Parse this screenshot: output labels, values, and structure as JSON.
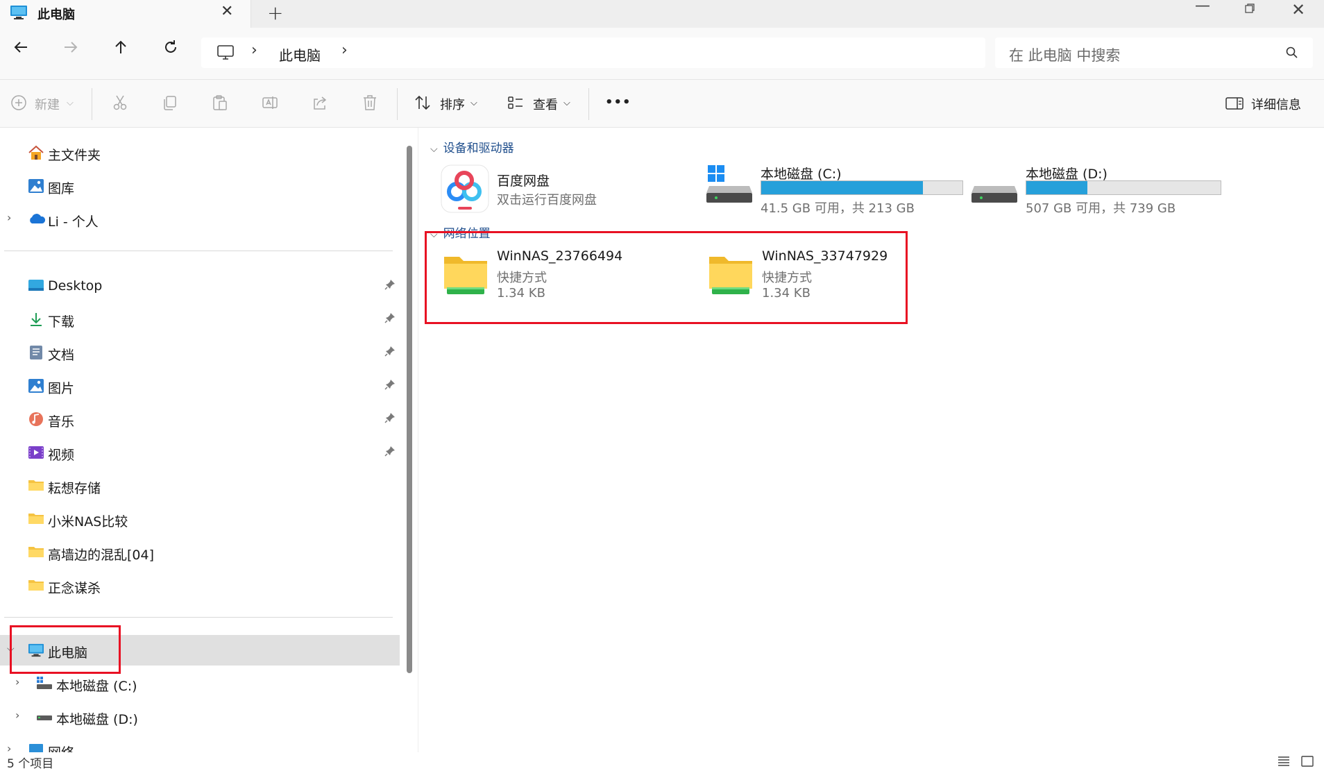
{
  "window": {
    "tab_title": "此电脑",
    "close_tab_glyph": "✕",
    "new_tab_glyph": "+",
    "minimize_glyph": "—",
    "close_window_glyph": "✕"
  },
  "address": {
    "breadcrumb": "此电脑",
    "search_placeholder": "在 此电脑 中搜索"
  },
  "toolbar": {
    "new_label": "新建",
    "sort_label": "排序",
    "view_label": "查看",
    "more_label": "•••",
    "details_label": "详细信息"
  },
  "sidebar": {
    "top": [
      {
        "label": "主文件夹",
        "icon": "home-icon"
      },
      {
        "label": "图库",
        "icon": "gallery-icon"
      },
      {
        "label": "Li - 个人",
        "icon": "onedrive-icon"
      }
    ],
    "quick": [
      {
        "label": "Desktop",
        "icon": "desktop-icon",
        "pinned": true
      },
      {
        "label": "下载",
        "icon": "download-icon",
        "pinned": true
      },
      {
        "label": "文档",
        "icon": "document-icon",
        "pinned": true
      },
      {
        "label": "图片",
        "icon": "pictures-icon",
        "pinned": true
      },
      {
        "label": "音乐",
        "icon": "music-icon",
        "pinned": true
      },
      {
        "label": "视频",
        "icon": "video-icon",
        "pinned": true
      },
      {
        "label": "耘想存储",
        "icon": "folder-icon",
        "pinned": false
      },
      {
        "label": "小米NAS比较",
        "icon": "folder-icon",
        "pinned": false
      },
      {
        "label": "高墙边的混乱[04]",
        "icon": "folder-icon",
        "pinned": false
      },
      {
        "label": "正念谋杀",
        "icon": "folder-icon",
        "pinned": false
      }
    ],
    "this_pc": "此电脑",
    "drive_c": "本地磁盘 (C:)",
    "drive_d": "本地磁盘 (D:)",
    "network": "网络"
  },
  "main": {
    "group_devices": "设备和驱动器",
    "group_network": "网络位置",
    "baidu": {
      "name": "百度网盘",
      "sub": "双击运行百度网盘"
    },
    "drive_c": {
      "name": "本地磁盘 (C:)",
      "sub": "41.5 GB 可用，共 213 GB",
      "used_fraction": 0.805
    },
    "drive_d": {
      "name": "本地磁盘 (D:)",
      "sub": "507 GB 可用，共 739 GB",
      "used_fraction": 0.314
    },
    "nas1": {
      "name": "WinNAS_23766494",
      "type": "快捷方式",
      "size": "1.34 KB"
    },
    "nas2": {
      "name": "WinNAS_33747929",
      "type": "快捷方式",
      "size": "1.34 KB"
    }
  },
  "status": {
    "item_count": "5 个项目"
  },
  "colors": {
    "accent": "#26a0da",
    "highlight": "#e81123",
    "selection": "#e0e0e0"
  }
}
